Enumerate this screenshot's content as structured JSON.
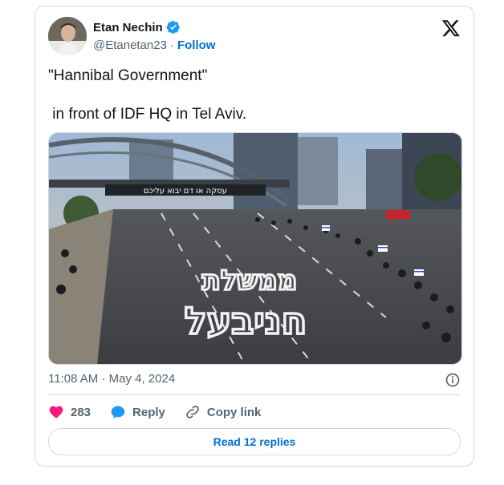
{
  "author": {
    "name": "Etan Nechin",
    "handle": "@Etanetan23",
    "separator": "·",
    "follow_label": "Follow"
  },
  "tweet": {
    "line1": "\"Hannibal Government\"",
    "line2": " in front of IDF HQ in Tel Aviv."
  },
  "photo": {
    "banner_text": "עסקה או דם יבוא עליכם",
    "road_text_line1": "ממשלת",
    "road_text_line2": "חניבעל"
  },
  "meta": {
    "time": "11:08 AM",
    "separator": "·",
    "date": "May 4, 2024"
  },
  "actions": {
    "like_count": "283",
    "reply_label": "Reply",
    "copy_link_label": "Copy link"
  },
  "read_replies_label": "Read 12 replies",
  "colors": {
    "link_blue": "#006fd6",
    "like_pink": "#f91880",
    "reply_blue": "#1d9bf0",
    "verified_blue": "#1d9bf0",
    "border": "#cfd9de",
    "muted": "#536471"
  },
  "icons": [
    "verified-badge-icon",
    "x-logo-icon",
    "info-icon",
    "heart-icon",
    "reply-bubble-icon",
    "link-icon"
  ]
}
